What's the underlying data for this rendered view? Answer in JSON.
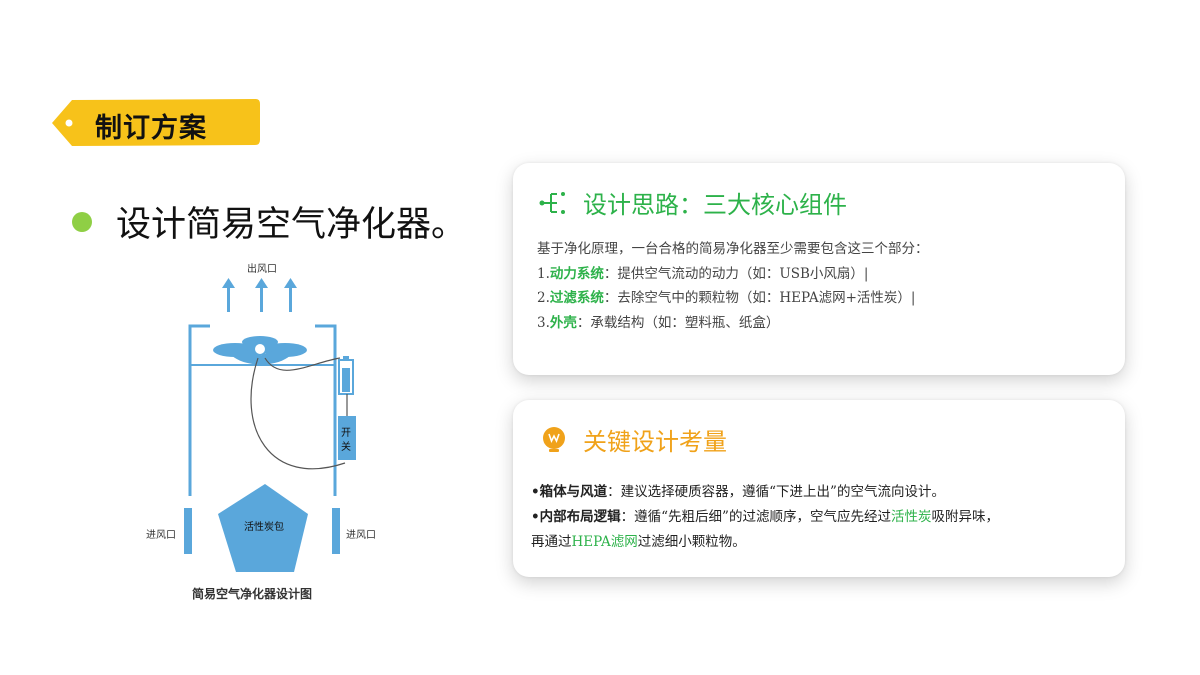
{
  "tag": {
    "label": "制订方案"
  },
  "heading": {
    "text": "设计简易空气净化器。"
  },
  "diagram": {
    "outlet_label": "出风口",
    "switch_label_1": "开",
    "switch_label_2": "关",
    "carbon_label": "活性炭包",
    "inlet_left_label": "进风口",
    "inlet_right_label": "进风口",
    "caption": "简易空气净化器设计图"
  },
  "card1": {
    "title": "设计思路：三大核心组件",
    "intro": "基于净化原理，一台合格的简易净化器至少需要包含这三个部分：",
    "items": [
      {
        "num": "1.",
        "key": "动力系统",
        "text": "：提供空气流动的动力（如：USB小风扇）|"
      },
      {
        "num": "2.",
        "key": "过滤系统",
        "text": "：去除空气中的颗粒物（如：HEPA滤网+活性炭）|"
      },
      {
        "num": "3.",
        "key": "外壳",
        "text": "：承载结构（如：塑料瓶、纸盒）"
      }
    ]
  },
  "card2": {
    "title": "关键设计考量",
    "line1_key": "•箱体与风道",
    "line1_text": "：建议选择硬质容器，遵循“下进上出”的空气流向设计。",
    "line2_key": "•内部布局逻辑",
    "line2_text_a": "：遵循“先粗后细”的过滤顺序，空气应先经过",
    "line2_hl1": "活性炭",
    "line2_text_b": "吸附异味，",
    "line3_text_a": "再通过",
    "line3_hl": "HEPA滤网",
    "line3_text_b": "过滤细小颗粒物。"
  },
  "colors": {
    "accent_yellow": "#f7c21a",
    "green": "#2db24a",
    "orange": "#f0a21a",
    "bullet_green": "#8fcf45",
    "diagram_blue": "#5aa7db"
  }
}
